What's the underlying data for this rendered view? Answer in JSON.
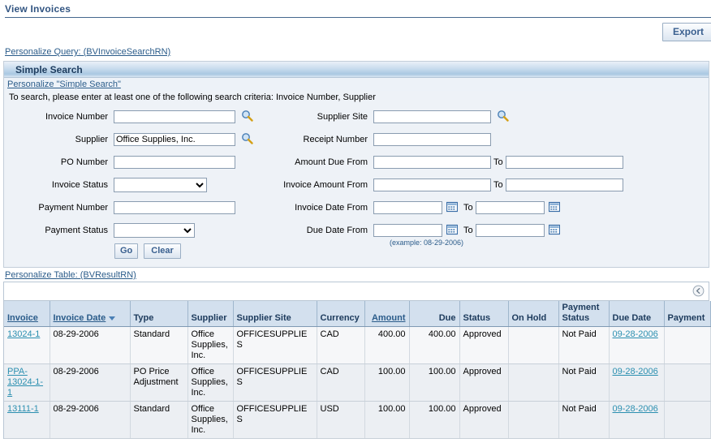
{
  "page": {
    "title": "View Invoices"
  },
  "toolbar": {
    "export_label": "Export"
  },
  "links": {
    "personalize_query": "Personalize Query: (BVInvoiceSearchRN)",
    "personalize_simple_search": "Personalize \"Simple Search\"",
    "personalize_table": "Personalize Table: (BVResultRN)"
  },
  "search_region": {
    "header_title": "Simple Search",
    "instruction": "To search, please enter at least one of the following search criteria: Invoice Number, Supplier",
    "example_note": "(example: 08-29-2006)",
    "to_label": "To",
    "go_label": "Go",
    "clear_label": "Clear",
    "left_fields": [
      {
        "label": "Invoice Number",
        "value": "",
        "type": "text",
        "has_lov": true
      },
      {
        "label": "Supplier",
        "value": "Office Supplies, Inc.",
        "type": "text",
        "has_lov": true
      },
      {
        "label": "PO Number",
        "value": "",
        "type": "text",
        "has_lov": false
      },
      {
        "label": "Invoice Status",
        "value": "",
        "type": "select",
        "has_lov": false
      },
      {
        "label": "Payment Number",
        "value": "",
        "type": "text",
        "has_lov": false
      },
      {
        "label": "Payment Status",
        "value": "",
        "type": "select",
        "has_lov": false
      }
    ],
    "right_fields": [
      {
        "label": "Supplier Site",
        "value": "",
        "to_value": null,
        "type": "text",
        "has_lov": true
      },
      {
        "label": "Receipt Number",
        "value": "",
        "to_value": null,
        "type": "text",
        "has_lov": false
      },
      {
        "label": "Amount Due From",
        "value": "",
        "to_value": "",
        "type": "range",
        "has_lov": false
      },
      {
        "label": "Invoice Amount From",
        "value": "",
        "to_value": "",
        "type": "range",
        "has_lov": false
      },
      {
        "label": "Invoice Date From",
        "value": "",
        "to_value": "",
        "type": "date",
        "has_lov": false
      },
      {
        "label": "Due Date From",
        "value": "",
        "to_value": "",
        "type": "date",
        "has_lov": false
      }
    ]
  },
  "results_table": {
    "columns": [
      {
        "label": "Invoice",
        "sortable": true,
        "align": "left",
        "sorted": false
      },
      {
        "label": "Invoice Date",
        "sortable": true,
        "align": "left",
        "sorted": "desc"
      },
      {
        "label": "Type",
        "sortable": false,
        "align": "left",
        "sorted": false
      },
      {
        "label": "Supplier",
        "sortable": false,
        "align": "left",
        "sorted": false
      },
      {
        "label": "Supplier Site",
        "sortable": false,
        "align": "left",
        "sorted": false
      },
      {
        "label": "Currency",
        "sortable": false,
        "align": "left",
        "sorted": false
      },
      {
        "label": "Amount",
        "sortable": true,
        "align": "right",
        "sorted": false
      },
      {
        "label": "Due",
        "sortable": false,
        "align": "right",
        "sorted": false
      },
      {
        "label": "Status",
        "sortable": false,
        "align": "left",
        "sorted": false
      },
      {
        "label": "On Hold",
        "sortable": false,
        "align": "left",
        "sorted": false
      },
      {
        "label": "Payment Status",
        "sortable": false,
        "align": "left",
        "sorted": false
      },
      {
        "label": "Due Date",
        "sortable": false,
        "align": "left",
        "sorted": false
      },
      {
        "label": "Payment",
        "sortable": false,
        "align": "left",
        "sorted": false
      }
    ],
    "rows": [
      {
        "invoice": "13024-1",
        "invoice_date": "08-29-2006",
        "type": "Standard",
        "supplier": "Office Supplies, Inc.",
        "supplier_site": "OFFICESUPPLIES",
        "currency": "CAD",
        "amount": "400.00",
        "due": "400.00",
        "status": "Approved",
        "on_hold": "",
        "payment_status": "Not Paid",
        "due_date": "09-28-2006",
        "payment": ""
      },
      {
        "invoice": "PPA-13024-1-1",
        "invoice_date": "08-29-2006",
        "type": "PO Price Adjustment",
        "supplier": "Office Supplies, Inc.",
        "supplier_site": "OFFICESUPPLIES",
        "currency": "CAD",
        "amount": "100.00",
        "due": "100.00",
        "status": "Approved",
        "on_hold": "",
        "payment_status": "Not Paid",
        "due_date": "09-28-2006",
        "payment": ""
      },
      {
        "invoice": "13111-1",
        "invoice_date": "08-29-2006",
        "type": "Standard",
        "supplier": "Office Supplies, Inc.",
        "supplier_site": "OFFICESUPPLIES",
        "currency": "USD",
        "amount": "100.00",
        "due": "100.00",
        "status": "Approved",
        "on_hold": "",
        "payment_status": "Not Paid",
        "due_date": "09-28-2006",
        "payment": ""
      }
    ]
  },
  "icons": {
    "lov_search": "magnifier-icon",
    "date_picker": "calendar-icon",
    "collapse": "collapse-left-icon",
    "sort_desc": "sort-descending-icon"
  },
  "colors": {
    "title_blue": "#315481",
    "link_blue": "#2b5c8a",
    "cell_link": "#2b8fb0",
    "region_bg": "#eef2f7",
    "header_cell": "#d3e0ee"
  }
}
